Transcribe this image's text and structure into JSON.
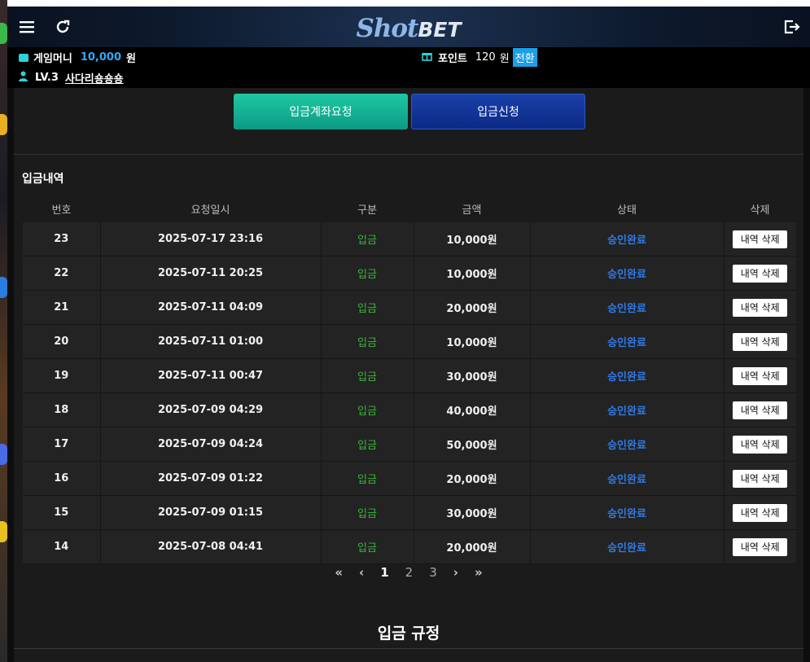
{
  "header": {
    "logo_primary": "Shot",
    "logo_secondary": "BET",
    "menu_icon": "hamburger-menu-icon",
    "refresh_icon": "refresh-icon",
    "logout_icon": "logout-icon"
  },
  "wallet": {
    "money_label": "게임머니",
    "money_value": "10,000",
    "money_unit": "원",
    "point_label": "포인트",
    "point_value": "120",
    "point_unit": "원",
    "convert_label": "전환"
  },
  "user": {
    "level": "LV.3",
    "name": "사다리숑숑숑"
  },
  "actions": {
    "account_request": "입금계좌요청",
    "deposit_request": "입금신청"
  },
  "history": {
    "title": "입금내역",
    "columns": [
      "번호",
      "요청일시",
      "구분",
      "금액",
      "상태",
      "삭제"
    ],
    "rows": [
      {
        "no": "23",
        "date": "2025-07-17 23:16",
        "type": "입금",
        "amount": "10,000원",
        "status": "승인완료",
        "action": "내역 삭제"
      },
      {
        "no": "22",
        "date": "2025-07-11 20:25",
        "type": "입금",
        "amount": "10,000원",
        "status": "승인완료",
        "action": "내역 삭제"
      },
      {
        "no": "21",
        "date": "2025-07-11 04:09",
        "type": "입금",
        "amount": "20,000원",
        "status": "승인완료",
        "action": "내역 삭제"
      },
      {
        "no": "20",
        "date": "2025-07-11 01:00",
        "type": "입금",
        "amount": "10,000원",
        "status": "승인완료",
        "action": "내역 삭제"
      },
      {
        "no": "19",
        "date": "2025-07-11 00:47",
        "type": "입금",
        "amount": "30,000원",
        "status": "승인완료",
        "action": "내역 삭제"
      },
      {
        "no": "18",
        "date": "2025-07-09 04:29",
        "type": "입금",
        "amount": "40,000원",
        "status": "승인완료",
        "action": "내역 삭제"
      },
      {
        "no": "17",
        "date": "2025-07-09 04:24",
        "type": "입금",
        "amount": "50,000원",
        "status": "승인완료",
        "action": "내역 삭제"
      },
      {
        "no": "16",
        "date": "2025-07-09 01:22",
        "type": "입금",
        "amount": "20,000원",
        "status": "승인완료",
        "action": "내역 삭제"
      },
      {
        "no": "15",
        "date": "2025-07-09 01:15",
        "type": "입금",
        "amount": "30,000원",
        "status": "승인완료",
        "action": "내역 삭제"
      },
      {
        "no": "14",
        "date": "2025-07-08 04:41",
        "type": "입금",
        "amount": "20,000원",
        "status": "승인완료",
        "action": "내역 삭제"
      }
    ]
  },
  "pagination": {
    "first": "«",
    "prev": "‹",
    "pages": [
      "1",
      "2",
      "3"
    ],
    "current": "1",
    "next": "›",
    "last": "»"
  },
  "rules": {
    "title": "입금 규정"
  },
  "colors": {
    "accent": "#2fa8ff",
    "teal_button": "#12b094",
    "blue_button": "#1a3a9e",
    "deposit_type": "#3bb53b",
    "status_approved": "#2f7be8"
  }
}
